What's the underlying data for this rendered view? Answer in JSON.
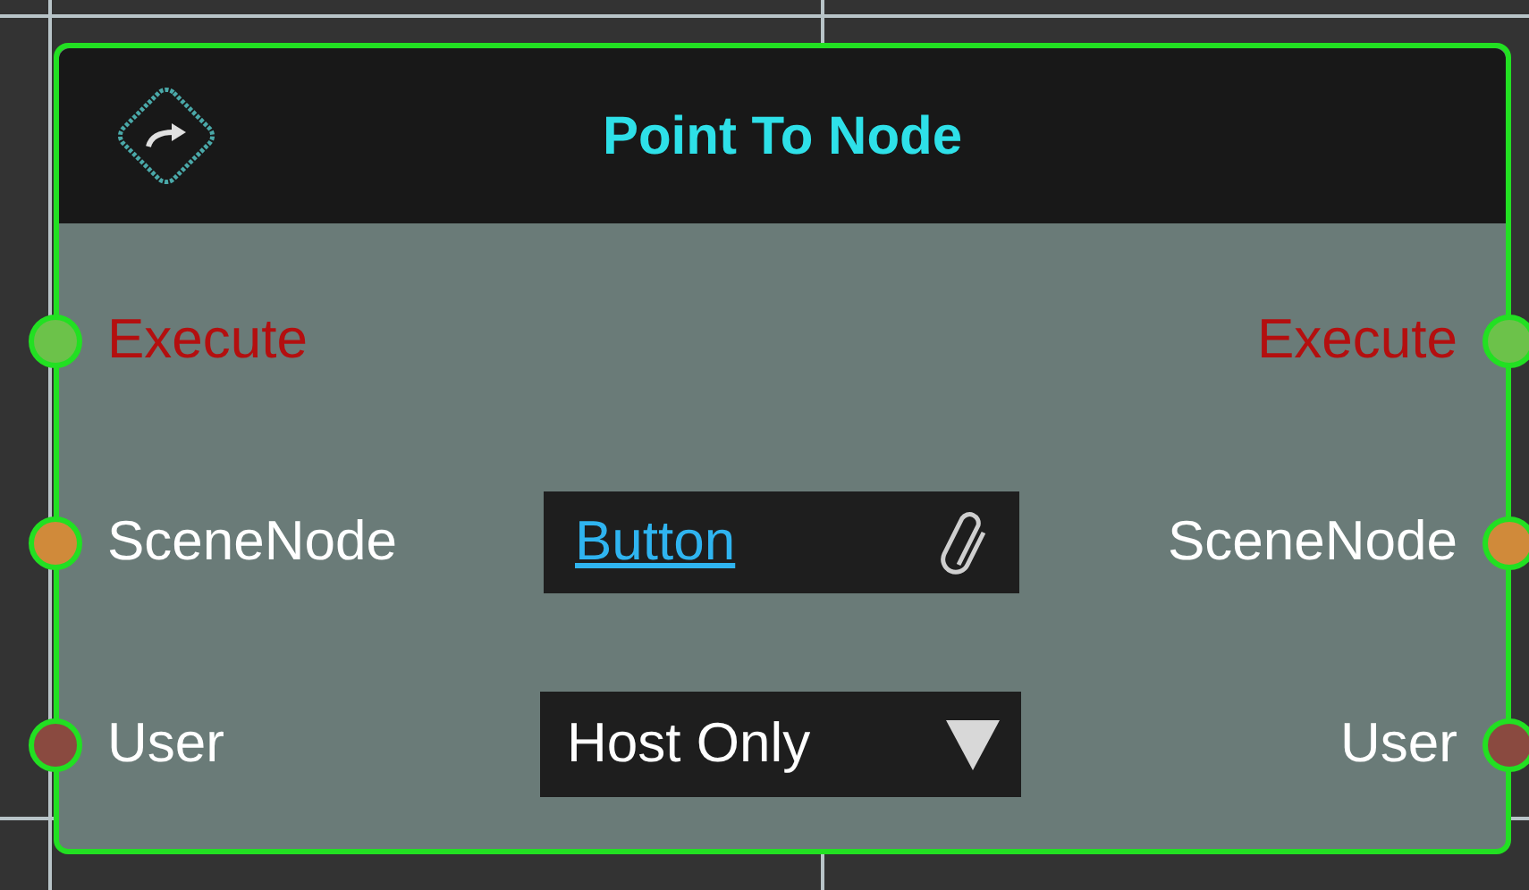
{
  "node": {
    "title": "Point To Node",
    "rows": [
      {
        "input": {
          "label": "Execute",
          "kind": "exec",
          "color": "#6cc24a"
        },
        "output": {
          "label": "Execute",
          "kind": "exec",
          "color": "#6cc24a"
        }
      },
      {
        "input": {
          "label": "SceneNode",
          "kind": "data",
          "color": "#d08a3a"
        },
        "widget": {
          "kind": "link",
          "value": "Button"
        },
        "output": {
          "label": "SceneNode",
          "kind": "data",
          "color": "#d08a3a"
        }
      },
      {
        "input": {
          "label": "User",
          "kind": "data",
          "color": "#8a4a40"
        },
        "widget": {
          "kind": "dropdown",
          "value": "Host Only"
        },
        "output": {
          "label": "User",
          "kind": "data",
          "color": "#8a4a40"
        }
      }
    ]
  }
}
